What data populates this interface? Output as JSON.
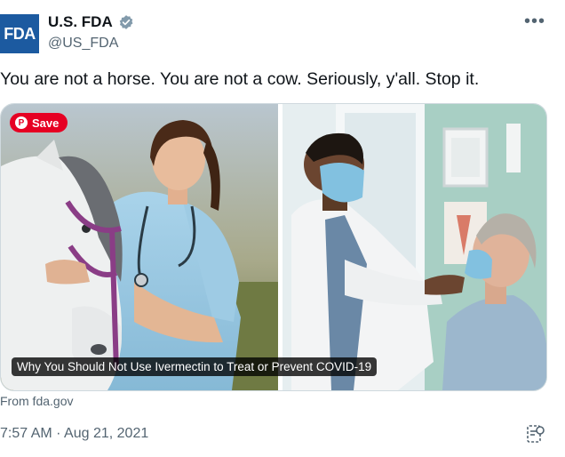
{
  "author": {
    "avatar_text": "FDA",
    "display_name": "U.S. FDA",
    "handle": "@US_FDA",
    "verified_icon": "verified-badge-icon"
  },
  "more_icon": "more-horizontal-icon",
  "tweet": {
    "text": "You are not a horse. You are not a cow. Seriously, y'all. Stop it."
  },
  "media": {
    "save_label": "Save",
    "caption": "Why You Should Not Use Ivermectin to Treat or Prevent COVID-19"
  },
  "link_source": "From fda.gov",
  "timestamp": "7:57 AM · Aug 21, 2021",
  "colors": {
    "fda_blue": "#1c5aa0",
    "verified": "#829aab",
    "pinterest_red": "#e60023",
    "secondary_text": "#536471"
  }
}
